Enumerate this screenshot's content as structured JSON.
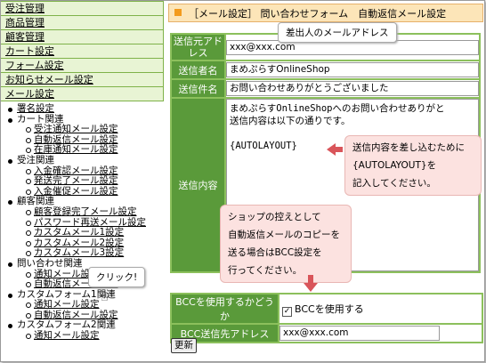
{
  "sidebar": {
    "menu": [
      "受注管理",
      "商品管理",
      "顧客管理",
      "カート設定",
      "フォーム設定",
      "お知らせメール設定",
      "メール設定"
    ],
    "tree": [
      {
        "type": "group",
        "label": "署名設定",
        "link": true
      },
      {
        "type": "group",
        "label": "カート関連",
        "link": false
      },
      {
        "type": "item",
        "label": "受注通知メール設定"
      },
      {
        "type": "item",
        "label": "自動返信メール設定"
      },
      {
        "type": "item",
        "label": "在庫通知メール設定"
      },
      {
        "type": "group",
        "label": "受注関連",
        "link": false
      },
      {
        "type": "item",
        "label": "入金確認メール設定"
      },
      {
        "type": "item",
        "label": "発送完了メール設定"
      },
      {
        "type": "item",
        "label": "入金催促メール設定"
      },
      {
        "type": "group",
        "label": "顧客関連",
        "link": false
      },
      {
        "type": "item",
        "label": "顧客登録完了メール設定"
      },
      {
        "type": "item",
        "label": "パスワード再送メール設定"
      },
      {
        "type": "item",
        "label": "カスタムメール1設定"
      },
      {
        "type": "item",
        "label": "カスタムメール2設定"
      },
      {
        "type": "item",
        "label": "カスタムメール3設定"
      },
      {
        "type": "group",
        "label": "問い合わせ関連",
        "link": false
      },
      {
        "type": "item",
        "label": "通知メール設定"
      },
      {
        "type": "item",
        "label": "自動返信メール設定"
      },
      {
        "type": "group",
        "label": "カスタムフォーム1関連",
        "link": false
      },
      {
        "type": "item",
        "label": "通知メール設定"
      },
      {
        "type": "item",
        "label": "自動返信メール設定"
      },
      {
        "type": "group",
        "label": "カスタムフォーム2関連",
        "link": false
      },
      {
        "type": "item",
        "label": "通知メール設定"
      }
    ]
  },
  "header": {
    "title": "［メール設定］ 問い合わせフォーム　自動返信メール設定"
  },
  "form": {
    "from_label": "送信元アドレス",
    "from_value": "xxx@xxx.com",
    "sender_label": "送信者名",
    "sender_value": "まめぷらすOnlineShop",
    "subject_label": "送信件名",
    "subject_value": "お問い合わせありがとうございました",
    "body_label": "送信内容",
    "body_lines": [
      "まめぷらすOnlineShopへのお問い合わせありがと",
      "送信内容は以下の通りです。",
      "",
      "{AUTOLAYOUT}"
    ],
    "bcc_use_label": "BCCを使用するかどうか",
    "bcc_use_check": "BCCを使用する",
    "bcc_addr_label": "BCC送信先アドレス",
    "bcc_addr_value": "xxx@xxx.com",
    "submit": "更新"
  },
  "annotations": {
    "from_note": "差出人のメールアドレス",
    "body_note_lines": [
      "送信内容を差し込むために",
      "{AUTOLAYOUT}を",
      "記入してください。"
    ],
    "bcc_note_lines": [
      "ショップの控えとして",
      "自動返信メールのコピーを",
      "送る場合はBCC設定を",
      "行ってください。"
    ],
    "click_note": "クリック!"
  },
  "colors": {
    "accent": "#5a9a3a",
    "note": "#fce2e0",
    "arrow": "#d9555a",
    "header": "#fce5b8"
  }
}
